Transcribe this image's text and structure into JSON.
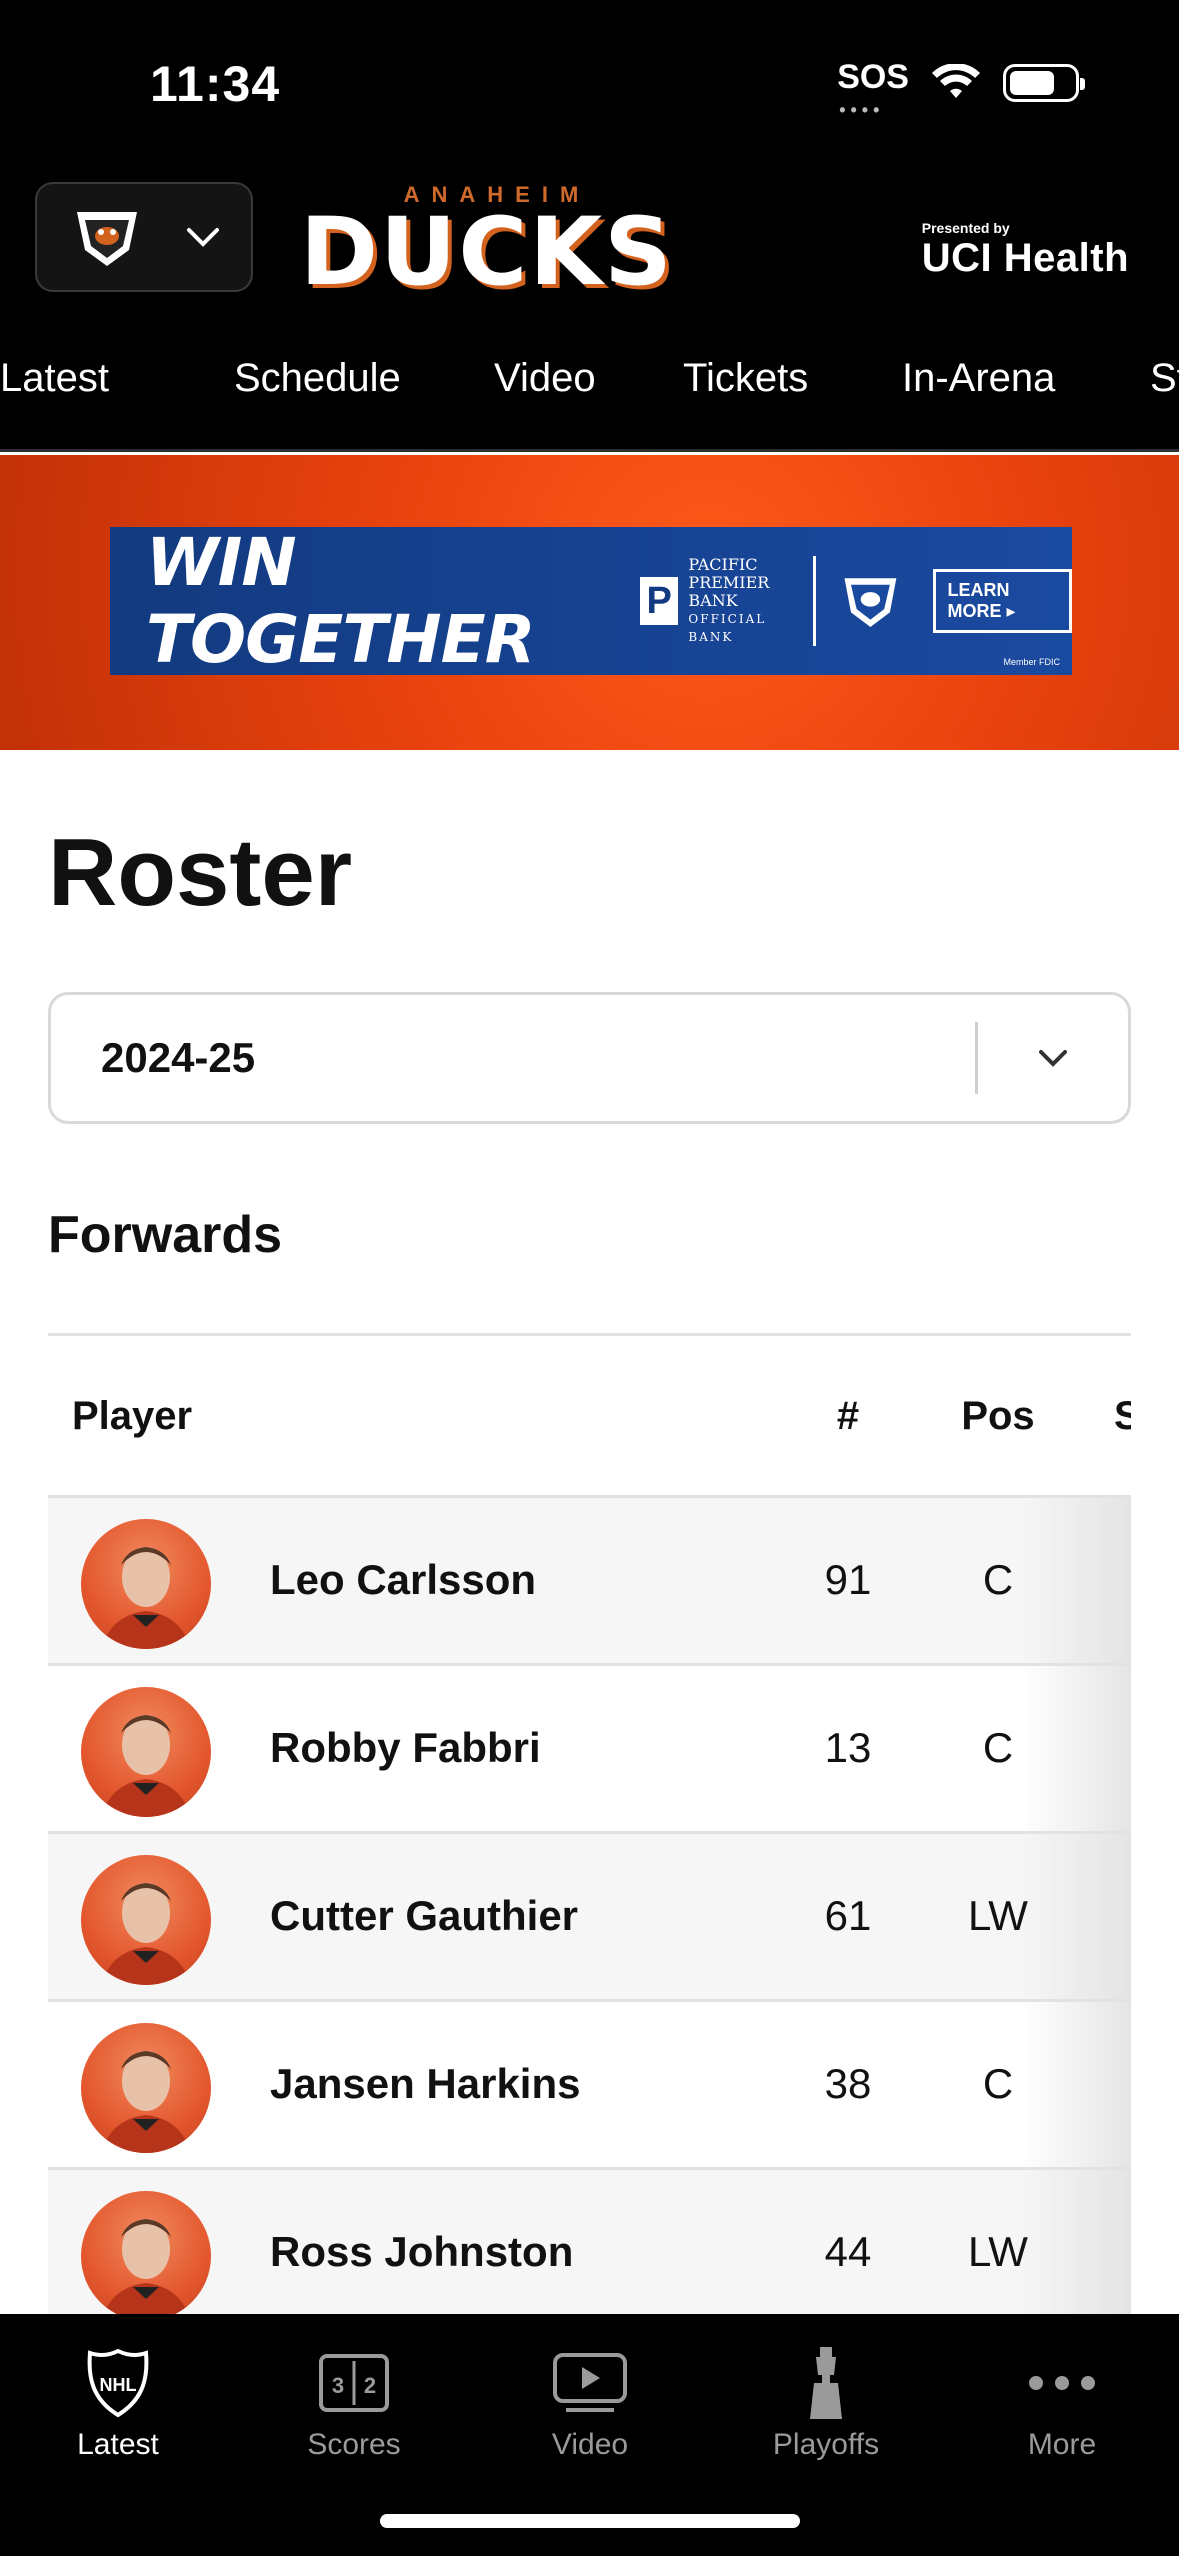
{
  "status_bar": {
    "time": "11:34",
    "sos": "SOS"
  },
  "header": {
    "brand_top": "ANAHEIM",
    "brand_main": "DUCKS",
    "sponsor_small": "Presented by",
    "sponsor_main": "UCI Health"
  },
  "tabs": [
    "Latest",
    "Schedule",
    "Video",
    "Tickets",
    "In-Arena",
    "St"
  ],
  "banner": {
    "headline": "WIN TOGETHER",
    "bank_lines": [
      "PACIFIC",
      "PREMIER",
      "BANK"
    ],
    "bank_sub": "OFFICIAL BANK",
    "cta": "LEARN MORE ▸",
    "fine_print": "Member FDIC"
  },
  "page": {
    "title": "Roster",
    "season": "2024-25",
    "section": "Forwards"
  },
  "table": {
    "headers": {
      "player": "Player",
      "number": "#",
      "position": "Pos",
      "more": "S"
    },
    "rows": [
      {
        "name": "Leo Carlsson",
        "number": "91",
        "pos": "C"
      },
      {
        "name": "Robby Fabbri",
        "number": "13",
        "pos": "C"
      },
      {
        "name": "Cutter Gauthier",
        "number": "61",
        "pos": "LW"
      },
      {
        "name": "Jansen Harkins",
        "number": "38",
        "pos": "C"
      },
      {
        "name": "Ross Johnston",
        "number": "44",
        "pos": "LW"
      }
    ]
  },
  "bottom_nav": [
    {
      "label": "Latest",
      "icon": "nhl-shield-icon",
      "active": true
    },
    {
      "label": "Scores",
      "icon": "scoreboard-icon",
      "active": false
    },
    {
      "label": "Video",
      "icon": "play-icon",
      "active": false
    },
    {
      "label": "Playoffs",
      "icon": "stanley-cup-icon",
      "active": false
    },
    {
      "label": "More",
      "icon": "more-dots-icon",
      "active": false
    }
  ],
  "colors": {
    "accent_orange": "#d3621f",
    "background_dark": "#000000",
    "ad_blue": "#1a4aa0"
  }
}
